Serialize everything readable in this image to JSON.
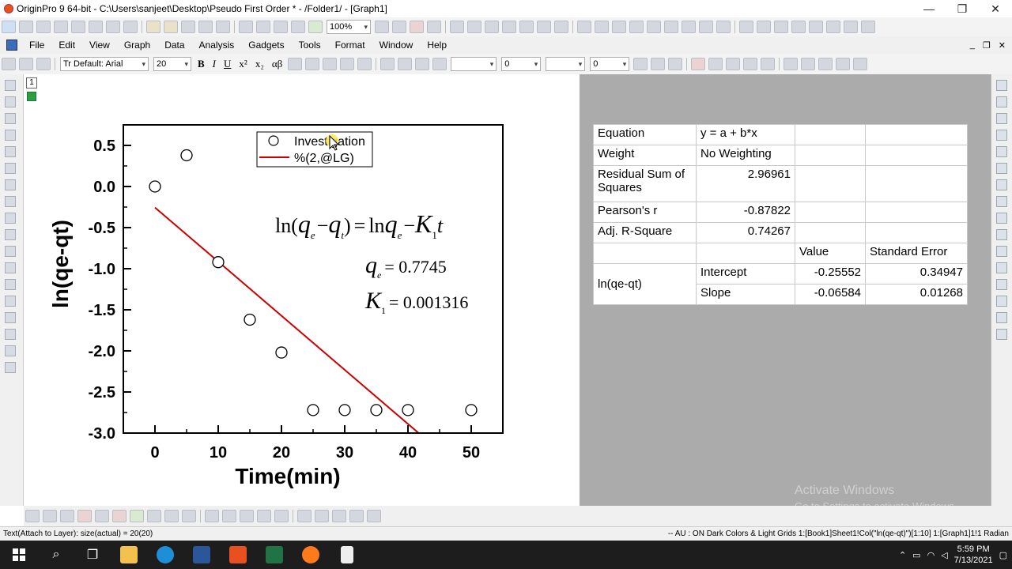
{
  "window": {
    "title": "OriginPro 9 64-bit - C:\\Users\\sanjeet\\Desktop\\Pseudo First Order * - /Folder1/ - [Graph1]",
    "min_glyph": "—",
    "max_glyph": "❐",
    "close_glyph": "✕"
  },
  "toolbar1": {
    "zoom": "100%"
  },
  "menu": {
    "items": [
      "File",
      "Edit",
      "View",
      "Graph",
      "Data",
      "Analysis",
      "Gadgets",
      "Tools",
      "Format",
      "Window",
      "Help"
    ],
    "mdi_min": "_",
    "mdi_restore": "❐",
    "mdi_close": "✕"
  },
  "format_toolbar": {
    "font": "Tr Default: Arial",
    "size": "20",
    "bold": "B",
    "italic": "I",
    "underline": "U",
    "superscript": "x²",
    "subscript": "x₂",
    "greek": "αβ",
    "line_width": "0",
    "border_width": "0"
  },
  "layer": {
    "number": "1"
  },
  "chart_data": {
    "type": "scatter",
    "xlabel": "Time(min)",
    "ylabel": "ln(qe-qt)",
    "xlim": [
      -5,
      55
    ],
    "ylim": [
      -3.0,
      0.75
    ],
    "xticks": [
      "0",
      "10",
      "20",
      "30",
      "40",
      "50"
    ],
    "yticks": [
      "0.5",
      "0.0",
      "-0.5",
      "-1.0",
      "-1.5",
      "-2.0",
      "-2.5",
      "-3.0"
    ],
    "series": [
      {
        "name": "Investigation",
        "style": "open-circle",
        "x": [
          0,
          5,
          10,
          15,
          20,
          25,
          30,
          35,
          40,
          50
        ],
        "y": [
          0.0,
          0.38,
          -0.92,
          -1.62,
          -2.02,
          -2.72,
          -2.72,
          -2.72,
          -2.72,
          -2.72
        ]
      },
      {
        "name": "%(2,@LG)",
        "style": "line",
        "color": "#cc0000",
        "intercept": -0.25552,
        "slope": -0.06584,
        "x_range": [
          0,
          50
        ]
      }
    ],
    "legend": "top-center",
    "annotations": {
      "equation": {
        "ln": "ln",
        "q": "q",
        "e": "e",
        "minus": "−",
        "t": "t",
        "eq": "=",
        "K": "K",
        "one": "1"
      },
      "qe_value": "= 0.7745",
      "k1_value": "= 0.001316"
    }
  },
  "report": {
    "rows": {
      "equation": {
        "label": "Equation",
        "value": "y = a + b*x"
      },
      "weight": {
        "label": "Weight",
        "value": "No Weighting"
      },
      "rss": {
        "label": "Residual Sum of Squares",
        "value": "2.96961"
      },
      "pearson": {
        "label": "Pearson's r",
        "value": "-0.87822"
      },
      "adjr2": {
        "label": "Adj. R-Square",
        "value": "0.74267"
      }
    },
    "header_value": "Value",
    "header_error": "Standard Error",
    "param_group": "ln(qe-qt)",
    "intercept": {
      "label": "Intercept",
      "value": "-0.25552",
      "error": "0.34947"
    },
    "slope": {
      "label": "Slope",
      "value": "-0.06584",
      "error": "0.01268"
    }
  },
  "watermark": {
    "line1": "Activate Windows",
    "line2": "Go to Settings to activate Windows."
  },
  "status": {
    "left": "Text(Attach to Layer): size(actual) = 20(20)",
    "right": "-- AU : ON  Dark Colors & Light Grids  1:[Book1]Sheet1!Col(\"ln(qe-qt)\")[1:10]  1:[Graph1]1!1  Radian"
  },
  "taskbar": {
    "time": "5:59 PM",
    "date": "7/13/2021"
  },
  "colors": {
    "fit_line": "#cc0000",
    "report_bg": "#ababab",
    "taskbar": "#1d1d1d"
  }
}
